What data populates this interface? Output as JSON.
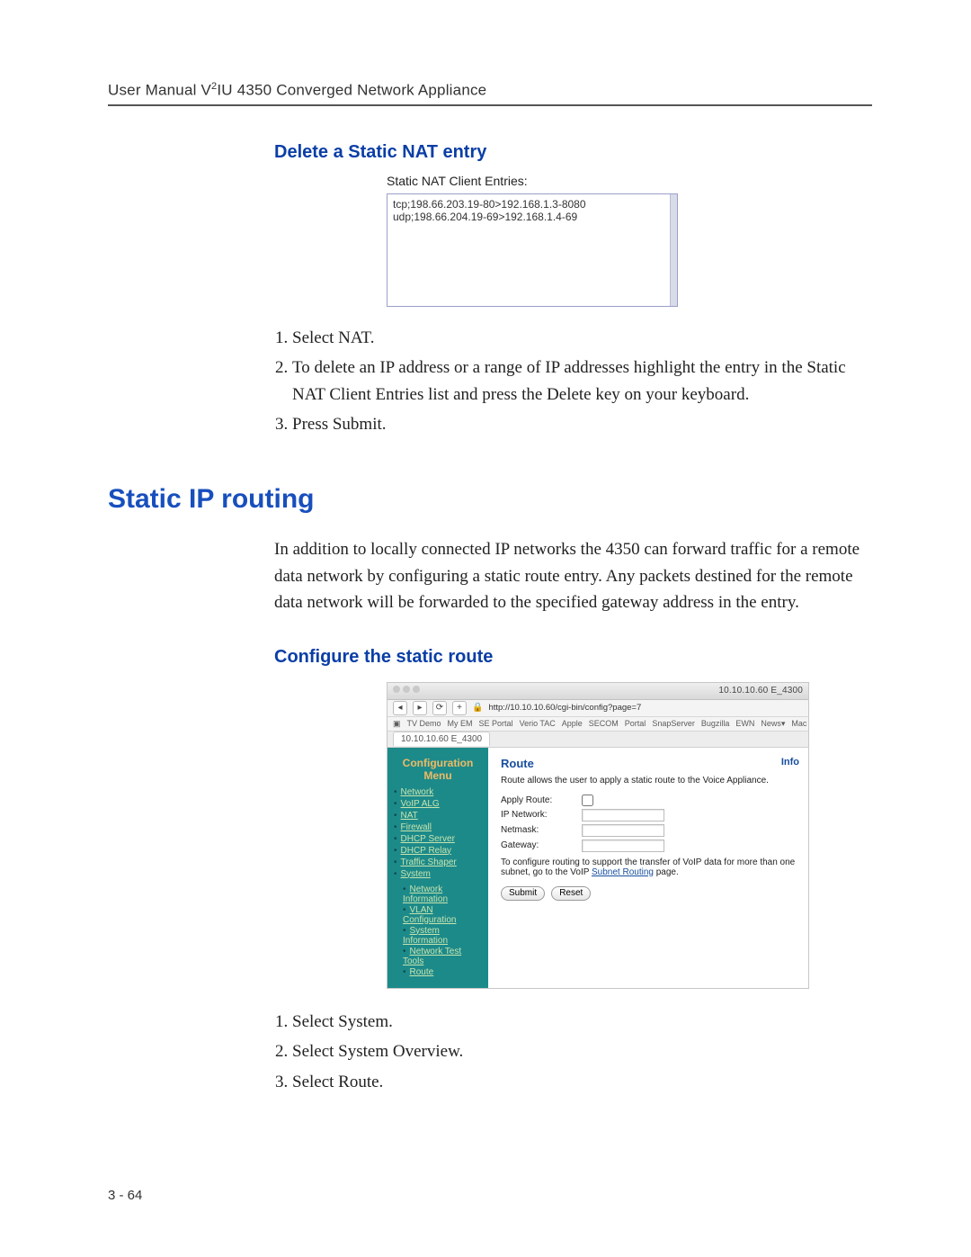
{
  "header": {
    "prefix": "User Manual V",
    "sup": "2",
    "suffix": "IU 4350 Converged Network Appliance"
  },
  "section1": {
    "title": "Delete a Static NAT entry",
    "nat_label": "Static NAT Client Entries:",
    "nat_lines": "tcp;198.66.203.19-80>192.168.1.3-8080\nudp;198.66.204.19-69>192.168.1.4-69",
    "steps": [
      "Select NAT.",
      "To delete an IP address or a range of IP addresses highlight the entry in the Static NAT Client Entries list and press the Delete key on your keyboard.",
      "Press Submit."
    ]
  },
  "section2": {
    "title": "Static IP routing",
    "intro": "In addition to locally connected IP networks the 4350 can forward traffic for a remote data network by configuring a static route entry. Any packets destined for the remote data network will be forwarded to the specified gateway address in the entry."
  },
  "section3": {
    "title": "Configure the static route",
    "steps": [
      "Select System.",
      "Select System Overview.",
      "Select Route."
    ]
  },
  "shot": {
    "window_dots": 3,
    "window_title": "10.10.10.60 E_4300",
    "url": "http://10.10.10.60/cgi-bin/config?page=7",
    "bookmarks": [
      "TV Demo",
      "My EM",
      "SE Portal",
      "Verio TAC",
      "Apple",
      "SECOM",
      "Portal",
      "SnapServer",
      "Bugzilla",
      "EWN",
      "News▾",
      "Mac N"
    ],
    "tab_label": "10.10.10.60 E_4300",
    "sidebar": {
      "title1": "Configuration",
      "title2": "Menu",
      "items": [
        "Network",
        "VoIP ALG",
        "NAT",
        "Firewall",
        "DHCP Server",
        "DHCP Relay",
        "Traffic Shaper",
        "System"
      ],
      "sys_sub": [
        "Network Information",
        "VLAN Configuration",
        "System Information",
        "Network Test Tools",
        "Route"
      ]
    },
    "pane": {
      "heading": "Route",
      "info": "Info",
      "desc": "Route allows the user to apply a static route to the Voice Appliance.",
      "labels": {
        "apply": "Apply Route:",
        "ipnet": "IP Network:",
        "netmask": "Netmask:",
        "gateway": "Gateway:"
      },
      "note_a": "To configure routing to support the transfer of VoIP data for more than one subnet, go to the VoIP ",
      "note_link": "Subnet Routing",
      "note_b": " page.",
      "submit": "Submit",
      "reset": "Reset"
    }
  },
  "footer": "3 - 64"
}
